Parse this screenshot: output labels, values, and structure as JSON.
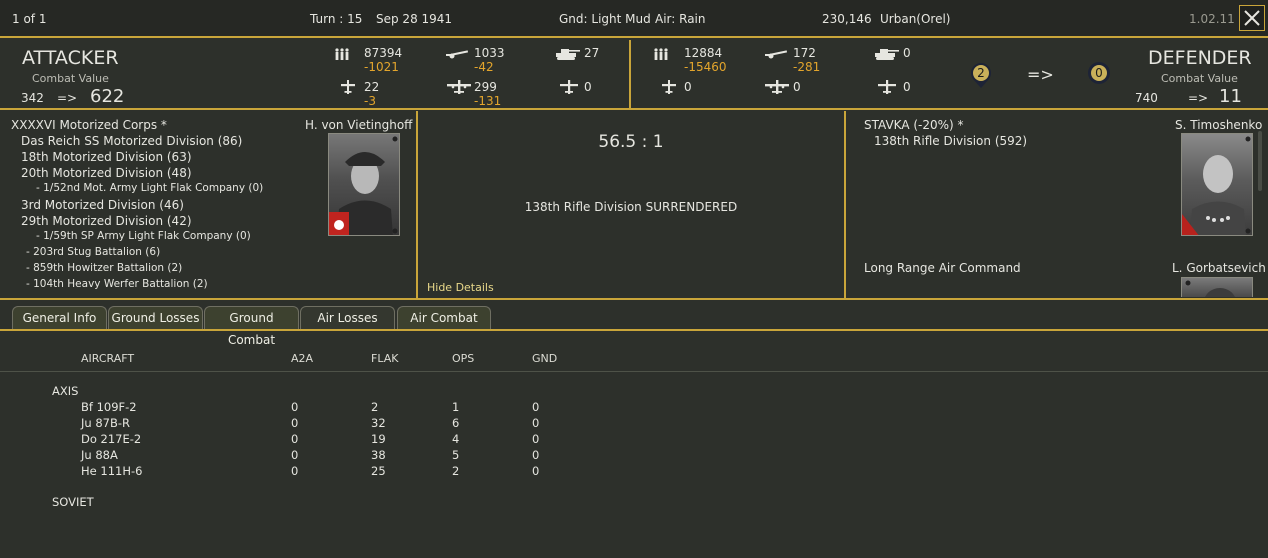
{
  "top": {
    "page": "1 of 1",
    "turn": "Turn : 15",
    "date": "Sep 28 1941",
    "ground": "Gnd: Light Mud",
    "air": "Air: Rain",
    "location_code": "230,146",
    "location": "Urban(Orel)",
    "version": "1.02.11"
  },
  "attacker": {
    "title": "ATTACKER",
    "cv_label": "Combat Value",
    "cv_from": "342",
    "arrow": "=>",
    "cv_to": "622",
    "men": "87394",
    "men_loss": "-1021",
    "guns": "1033",
    "guns_loss": "-42",
    "tanks": "27",
    "fighters": "22",
    "fighters_loss": "-3",
    "bombers": "299",
    "bombers_loss": "-131",
    "other_air": "0",
    "hq": "XXXXVI Motorized Corps *",
    "commander": "H. von Vietinghoff",
    "units": [
      "Das Reich SS Motorized Division (86)",
      "18th Motorized Division (63)",
      "20th Motorized Division (48)",
      "- 1/52nd Mot. Army Light Flak Company (0)",
      "3rd Motorized Division (46)",
      "29th Motorized Division (42)",
      "- 1/59th SP Army Light Flak Company (0)",
      "- 203rd Stug Battalion (6)",
      "- 859th Howitzer Battalion (2)",
      "- 104th Heavy Werfer Battalion (2)"
    ]
  },
  "defender": {
    "title": "DEFENDER",
    "cv_label": "Combat Value",
    "cv_from": "740",
    "arrow": "=>",
    "cv_to": "11",
    "men": "12884",
    "men_loss": "-15460",
    "guns": "172",
    "guns_loss": "-281",
    "tanks": "0",
    "fighters": "0",
    "bombers": "0",
    "other_air": "0",
    "fort_from": "2",
    "fort_arrow": "=>",
    "fort_to": "0",
    "hq": "STAVKA (-20%) *",
    "commander": "S. Timoshenko",
    "units": [
      "138th Rifle Division (592)"
    ],
    "air_hq": "Long Range Air Command",
    "air_commander": "L. Gorbatsevich"
  },
  "result": {
    "odds": "56.5 : 1",
    "message": "138th Rifle Division SURRENDERED",
    "hide_details": "Hide Details"
  },
  "tabs": [
    "General Info",
    "Ground Losses",
    "Ground Combat",
    "Air Losses",
    "Air Combat"
  ],
  "table": {
    "headers": [
      "AIRCRAFT",
      "A2A",
      "FLAK",
      "OPS",
      "GND"
    ],
    "group_axis": "AXIS",
    "rows": [
      [
        "Bf 109F-2",
        "0",
        "2",
        "1",
        "0"
      ],
      [
        "Ju 87B-R",
        "0",
        "32",
        "6",
        "0"
      ],
      [
        "Do 217E-2",
        "0",
        "19",
        "4",
        "0"
      ],
      [
        "Ju 88A",
        "0",
        "38",
        "5",
        "0"
      ],
      [
        "He 111H-6",
        "0",
        "25",
        "2",
        "0"
      ]
    ],
    "group_soviet": "SOVIET"
  },
  "colors": {
    "border": "#c9a53a",
    "loss": "#e3a52c",
    "bg": "#2d302b"
  }
}
